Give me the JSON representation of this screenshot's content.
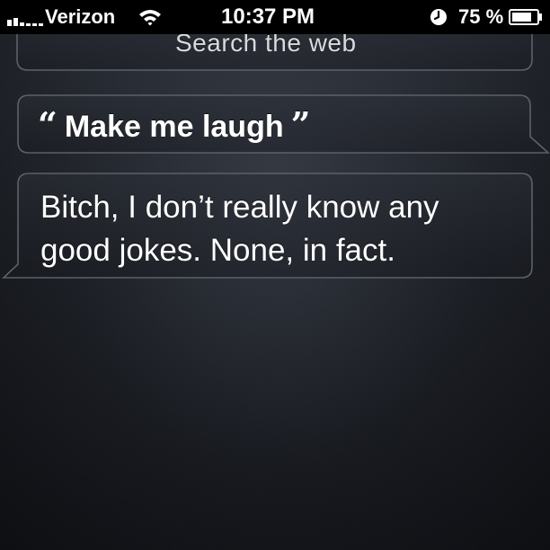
{
  "status_bar": {
    "carrier": "Verizon",
    "time": "10:37 PM",
    "battery_percent": "75 %",
    "icons": [
      "signal-bars-icon",
      "wifi-icon",
      "alarm-clock-icon",
      "battery-icon"
    ]
  },
  "siri": {
    "previous_item": "Search the web",
    "query": {
      "open_quote": "“",
      "text": "Make me laugh",
      "close_quote": "”"
    },
    "response_lines": [
      "Bitch, I don’t really know any",
      "good jokes. None, in fact."
    ]
  }
}
